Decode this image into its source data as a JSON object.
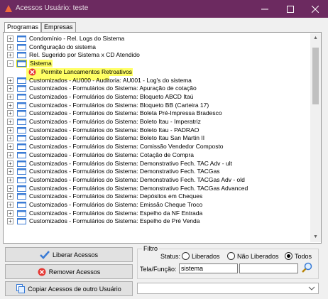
{
  "window": {
    "title": "Acessos Usuário: teste"
  },
  "tabs": [
    {
      "label": "Programas",
      "active": true
    },
    {
      "label": "Empresas",
      "active": false
    }
  ],
  "tree": {
    "rows": [
      {
        "label": "Condomínio - Rel. Logs do Sistema",
        "expander": "+"
      },
      {
        "label": "Configuração do sistema",
        "expander": "+"
      },
      {
        "label": "Rel. Sugerido por Sistema x CD Atendido",
        "expander": "+"
      },
      {
        "label": "Sistema",
        "expander": "-",
        "highlight": true
      },
      {
        "label": "Permite Lancamentos Retroativos",
        "child": true
      },
      {
        "label": "Customizados - AU000 - Auditoria: AU001 - Log's do sistema",
        "expander": "+"
      },
      {
        "label": "Customizados - Formulários do Sistema: Apuração de cotação",
        "expander": "+"
      },
      {
        "label": "Customizados - Formulários do Sistema: Bloqueto ABCD Itaú",
        "expander": "+"
      },
      {
        "label": "Customizados - Formulários do Sistema: Bloqueto BB (Carteira 17)",
        "expander": "+"
      },
      {
        "label": "Customizados - Formulários do Sistema: Boleta Pré-Impressa Bradesco",
        "expander": "+"
      },
      {
        "label": "Customizados - Formulários do Sistema: Boleto Itau - Imperatriz",
        "expander": "+"
      },
      {
        "label": "Customizados - Formulários do Sistema: Boleto Itau - PADRAO",
        "expander": "+"
      },
      {
        "label": "Customizados - Formulários do Sistema: Boleto Itau San Martin II",
        "expander": "+"
      },
      {
        "label": "Customizados - Formulários do Sistema: Comissão Vendedor Composto",
        "expander": "+"
      },
      {
        "label": "Customizados - Formulários do Sistema: Cotação de Compra",
        "expander": "+"
      },
      {
        "label": "Customizados - Formulários do Sistema: Demonstrativo Fech. TAC Adv - ult",
        "expander": "+"
      },
      {
        "label": "Customizados - Formulários do Sistema: Demonstrativo Fech. TACGas",
        "expander": "+"
      },
      {
        "label": "Customizados - Formulários do Sistema: Demonstrativo Fech. TACGas Adv - old",
        "expander": "+"
      },
      {
        "label": "Customizados - Formulários do Sistema: Demonstrativo Fech. TACGas Advanced",
        "expander": "+"
      },
      {
        "label": "Customizados - Formulários do Sistema: Depósitos em Cheques",
        "expander": "+"
      },
      {
        "label": "Customizados - Formulários do Sistema: Emissão Cheque Troco",
        "expander": "+"
      },
      {
        "label": "Customizados - Formulários do Sistema: Espelho da NF Entrada",
        "expander": "+"
      },
      {
        "label": "Customizados - Formulários do Sistema: Espelho de Pré Venda",
        "expander": "+"
      }
    ]
  },
  "buttons": {
    "liberar": "Liberar Acessos",
    "remover": "Remover Acessos",
    "copiar": "Copiar Acessos de outro Usuário"
  },
  "filtro": {
    "label": "Filtro",
    "status_label": "Status:",
    "options": [
      "Liberados",
      "Não Liberados",
      "Todos"
    ],
    "selected": "Todos",
    "tela_label": "Tela/Função:",
    "tela_value": "sistema",
    "second_value": ""
  },
  "combo": {
    "value": ""
  },
  "colors": {
    "titlebar": "#6c2a60",
    "highlight": "#ffff66"
  }
}
